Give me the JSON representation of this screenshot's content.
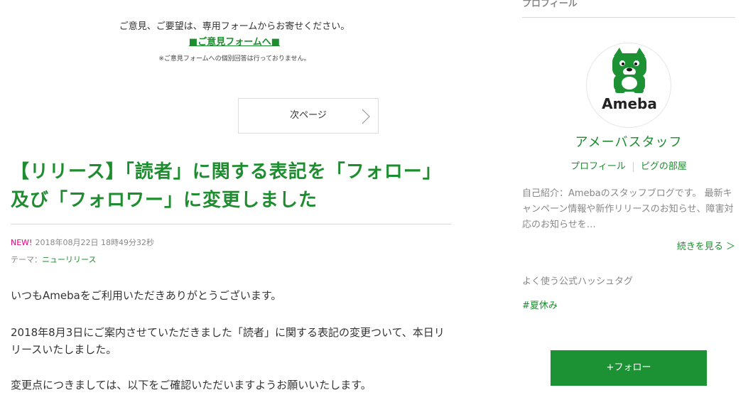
{
  "notice": {
    "line": "ご意見、ご要望は、専用フォームからお寄せください。",
    "link": "■ご意見フォームへ■",
    "note": "※ご意見フォームへの個別回答は行っておりません。"
  },
  "pager": {
    "next_label": "次ページ"
  },
  "article": {
    "title": "【リリース】「読者」に関する表記を「フォロー」及び「フォロワー」に変更しました",
    "new_badge": "NEW!",
    "datetime": "2018年08月22日 18時49分32秒",
    "theme_label": "テーマ：",
    "theme": "ニューリリース",
    "paragraphs": [
      "いつもAmebaをご利用いただきありがとうございます。",
      "2018年8月3日にご案内させていただきました「読者」に関する表記の変更ついて、本日リリースいたしました。",
      "変更点につきましては、以下をご確認いただいますようお願いいたします。"
    ]
  },
  "sidebar": {
    "heading": "プロフィール",
    "logo_text": "Ameba",
    "name": "アメーバスタッフ",
    "link_profile": "プロフィール",
    "link_room": "ピグの部屋",
    "intro": "自己紹介：Amebaのスタッフブログです。 最新キャンペーン情報や新作リリースのお知らせ、障害対応のお知らせを…",
    "more": "続きを見る ＞",
    "hashtag_heading": "よく使う公式ハッシュタグ",
    "hashtag": "#夏休み",
    "follow_label": "+フォロー"
  },
  "colors": {
    "accent": "#1d8d2f",
    "new_badge": "#e6007e",
    "follow_button": "#1d9235"
  }
}
